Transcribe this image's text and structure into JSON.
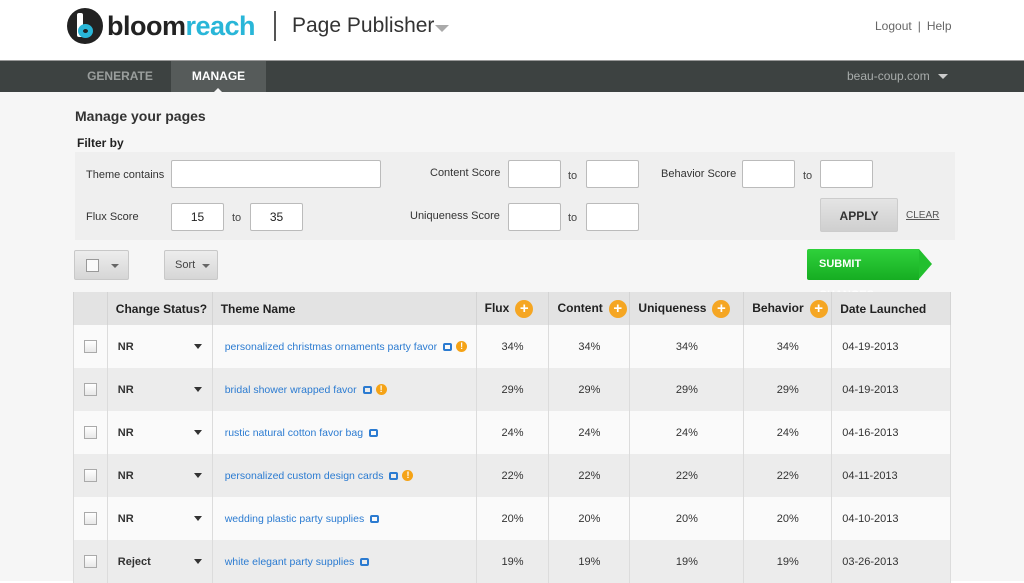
{
  "header": {
    "logo_part1": "bloom",
    "logo_part2": "reach",
    "app_title": "Page Publisher",
    "logout": "Logout",
    "separator": "|",
    "help": "Help"
  },
  "nav": {
    "tabs": [
      {
        "label": "GENERATE",
        "active": false
      },
      {
        "label": "MANAGE",
        "active": true
      }
    ],
    "site": "beau-coup.com"
  },
  "page": {
    "title": "Manage your pages",
    "filter_by": "Filter by"
  },
  "filters": {
    "theme_contains": {
      "label": "Theme contains",
      "value": ""
    },
    "flux_score": {
      "label": "Flux Score",
      "from": "15",
      "to": "35"
    },
    "content_score": {
      "label": "Content Score",
      "from": "",
      "to": ""
    },
    "uniqueness_score": {
      "label": "Uniqueness Score",
      "from": "",
      "to": ""
    },
    "behavior_score": {
      "label": "Behavior Score",
      "from": "",
      "to": ""
    },
    "to_label": "to",
    "apply": "APPLY",
    "clear": "CLEAR"
  },
  "toolbar": {
    "sort": "Sort",
    "submit": "SUBMIT CHANGES"
  },
  "colors": {
    "accent_orange": "#f5a623",
    "link_blue": "#2b7bd1",
    "submit_green": "#22bf2e",
    "nav_dark": "#3d4241",
    "logo_cyan": "#29b6d8"
  },
  "table": {
    "headers": {
      "status": "Change Status?",
      "theme": "Theme Name",
      "flux": "Flux",
      "content": "Content",
      "uniqueness": "Uniqueness",
      "behavior": "Behavior",
      "date": "Date Launched"
    },
    "rows": [
      {
        "status": "NR",
        "theme": "personalized christmas ornaments party favor",
        "warning": true,
        "flux": "34%",
        "content": "34%",
        "uniqueness": "34%",
        "behavior": "34%",
        "date": "04-19-2013"
      },
      {
        "status": "NR",
        "theme": "bridal shower wrapped favor",
        "warning": true,
        "flux": "29%",
        "content": "29%",
        "uniqueness": "29%",
        "behavior": "29%",
        "date": "04-19-2013"
      },
      {
        "status": "NR",
        "theme": "rustic natural cotton favor bag",
        "warning": false,
        "flux": "24%",
        "content": "24%",
        "uniqueness": "24%",
        "behavior": "24%",
        "date": "04-16-2013"
      },
      {
        "status": "NR",
        "theme": "personalized custom  design cards",
        "warning": true,
        "flux": "22%",
        "content": "22%",
        "uniqueness": "22%",
        "behavior": "22%",
        "date": "04-11-2013"
      },
      {
        "status": "NR",
        "theme": "wedding plastic party supplies",
        "warning": false,
        "flux": "20%",
        "content": "20%",
        "uniqueness": "20%",
        "behavior": "20%",
        "date": "04-10-2013"
      },
      {
        "status": "Reject",
        "theme": "white elegant party supplies",
        "warning": false,
        "flux": "19%",
        "content": "19%",
        "uniqueness": "19%",
        "behavior": "19%",
        "date": "03-26-2013"
      }
    ]
  }
}
